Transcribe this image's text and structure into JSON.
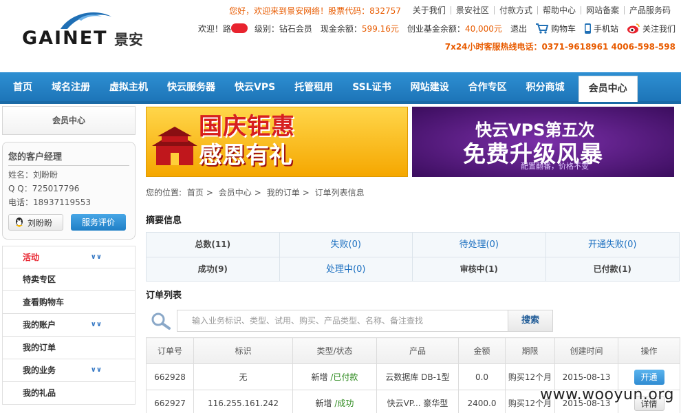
{
  "header": {
    "logo_text": "GAINET",
    "logo_cn": "景安",
    "welcome": "您好，欢迎来到景安网络！股票代码：832757",
    "top_links": [
      "关于我们",
      "景安社区",
      "付款方式",
      "帮助中心",
      "网站备案",
      "产品服务码"
    ],
    "user_greeting": "欢迎！",
    "user_name": "路",
    "level_label": "级别：",
    "level_value": "钻石会员",
    "cash_label": "现金余额：",
    "cash_value": "599.16元",
    "fund_label": "创业基金余额：",
    "fund_value": "40,000元",
    "logout": "退出",
    "cart": "购物车",
    "mobile": "手机站",
    "follow": "关注我们",
    "hotline": "7x24小时客服热线电话：0371-9618961  4006-598-598"
  },
  "nav": {
    "items": [
      "首页",
      "域名注册",
      "虚拟主机",
      "快云服务器",
      "快云VPS",
      "托管租用",
      "SSL证书",
      "网站建设",
      "合作专区",
      "积分商城"
    ],
    "active": "会员中心"
  },
  "sidebar": {
    "title": "会员中心",
    "manager": {
      "title": "您的客户经理",
      "name": "姓名：刘盼盼",
      "qq": "Q Q：725017796",
      "phone": "电话：18937119553",
      "qq_button": "刘盼盼",
      "eval_button": "服务评价"
    },
    "menu": [
      {
        "label": "活动",
        "chevron": true
      },
      {
        "label": "特卖专区",
        "chevron": false
      },
      {
        "label": "查看购物车",
        "chevron": false
      },
      {
        "label": "我的账户",
        "chevron": true
      },
      {
        "label": "我的订单",
        "chevron": false
      },
      {
        "label": "我的业务",
        "chevron": true
      },
      {
        "label": "我的礼品",
        "chevron": false
      }
    ]
  },
  "banners": {
    "b1_line1": "国庆钜惠",
    "b1_line2": "感恩有礼",
    "b2_line1": "快云VPS第五次",
    "b2_line2": "免费升级风暴",
    "b2_line3": "配置翻番，价格不变"
  },
  "breadcrumb": {
    "prefix": "您的位置:",
    "items": [
      "首页",
      "会员中心",
      "我的订单",
      "订单列表信息"
    ]
  },
  "summary": {
    "title": "摘要信息",
    "cells": [
      "总数(11)",
      "失败(0)",
      "待处理(0)",
      "开通失败(0)",
      "成功(9)",
      "处理中(0)",
      "审核中(1)",
      "已付款(1)"
    ]
  },
  "orders": {
    "title": "订单列表",
    "search_placeholder": "输入业务标识、类型、试用、购买、产品类型、名称、备注查找",
    "search_button": "搜索",
    "columns": [
      "订单号",
      "标识",
      "类型/状态",
      "产品",
      "金额",
      "期限",
      "创建时间",
      "操作"
    ],
    "rows": [
      {
        "id": "662928",
        "tag": "无",
        "type": "新增",
        "status": "/已付款",
        "product": "云数据库 DB-1型",
        "amount": "0.0",
        "term": "购买12个月",
        "created": "2015-08-13",
        "action": "开通"
      },
      {
        "id": "662927",
        "tag": "116.255.161.242",
        "type": "新增",
        "status": "/成功",
        "product": "快云VP... 豪华型",
        "amount": "2400.0",
        "term": "购买12个月",
        "created": "2015-08-13",
        "action": "详情"
      }
    ]
  },
  "watermark": "www.wooyun.org",
  "colors": {
    "nav_blue": "#2e8fd2",
    "accent_orange": "#e85b00",
    "link_blue": "#1b6fc0"
  }
}
